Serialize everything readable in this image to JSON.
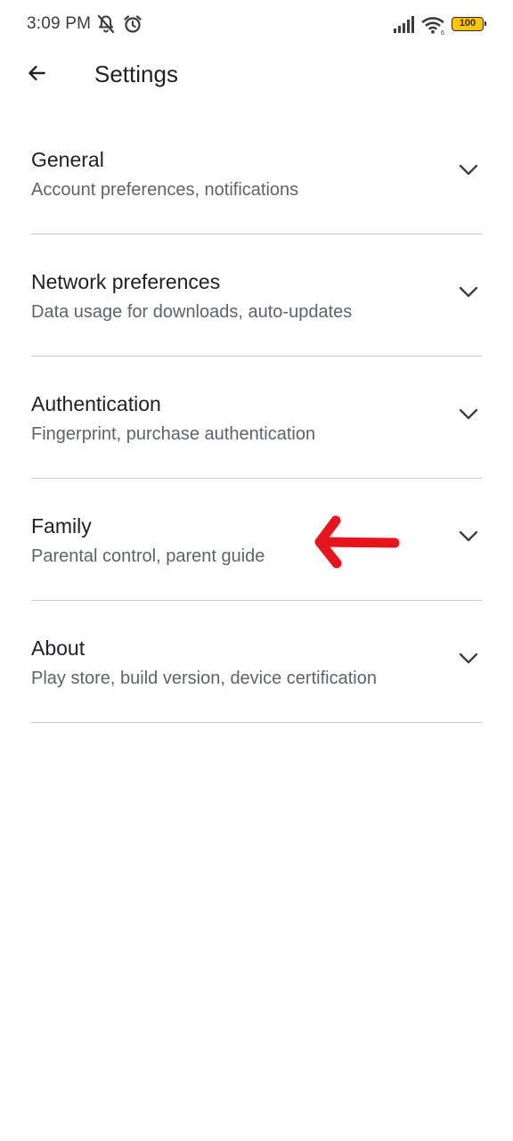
{
  "status_bar": {
    "time": "3:09 PM",
    "battery": "100",
    "icons": [
      "notifications-off-icon",
      "alarm-icon",
      "signal-icon",
      "wifi-icon",
      "battery-icon"
    ]
  },
  "app_bar": {
    "title": "Settings",
    "back_icon": "arrow-back-icon"
  },
  "settings": [
    {
      "title": "General",
      "subtitle": "Account preferences, notifications"
    },
    {
      "title": "Network preferences",
      "subtitle": "Data usage for downloads, auto-updates"
    },
    {
      "title": "Authentication",
      "subtitle": "Fingerprint, purchase authentication"
    },
    {
      "title": "Family",
      "subtitle": "Parental control, parent guide"
    },
    {
      "title": "About",
      "subtitle": "Play store, build version, device certification"
    }
  ],
  "annotation": {
    "color": "#e8141b",
    "icon": "red-arrow-left-icon"
  }
}
